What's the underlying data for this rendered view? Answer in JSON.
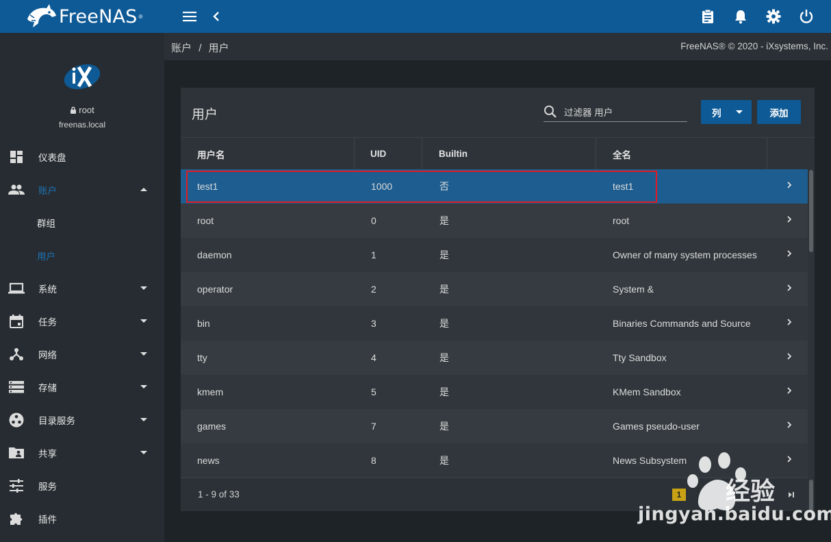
{
  "header": {
    "logo_text": "FreeNAS",
    "logo_mark": "®",
    "icons": [
      "menu-icon",
      "back-icon",
      "clipboard-icon",
      "bell-icon",
      "gear-icon",
      "power-icon"
    ]
  },
  "sidebar": {
    "user": "root",
    "host": "freenas.local",
    "items": [
      {
        "label": "仪表盘",
        "icon": "dashboard-icon"
      },
      {
        "label": "账户",
        "icon": "people-icon",
        "expanded": true
      },
      {
        "label": "群组"
      },
      {
        "label": "用户",
        "active": true
      },
      {
        "label": "系统",
        "icon": "laptop-icon"
      },
      {
        "label": "任务",
        "icon": "calendar-icon"
      },
      {
        "label": "网络",
        "icon": "network-icon"
      },
      {
        "label": "存储",
        "icon": "storage-icon"
      },
      {
        "label": "目录服务",
        "icon": "directory-icon"
      },
      {
        "label": "共享",
        "icon": "folder-share-icon"
      },
      {
        "label": "服务",
        "icon": "sliders-icon"
      },
      {
        "label": "插件",
        "icon": "puzzle-icon"
      }
    ]
  },
  "breadcrumb": {
    "parent": "账户",
    "sep": "/",
    "current": "用户"
  },
  "copyright": "FreeNAS® © 2020 - iXsystems, Inc.",
  "card": {
    "title": "用户",
    "search_placeholder": "过滤器 用户",
    "columns_button": "列",
    "add_button": "添加"
  },
  "table": {
    "headers": [
      "用户名",
      "UID",
      "Builtin",
      "全名"
    ],
    "rows": [
      {
        "username": "test1",
        "uid": "1000",
        "builtin": "否",
        "fullname": "test1"
      },
      {
        "username": "root",
        "uid": "0",
        "builtin": "是",
        "fullname": "root"
      },
      {
        "username": "daemon",
        "uid": "1",
        "builtin": "是",
        "fullname": "Owner of many system processes"
      },
      {
        "username": "operator",
        "uid": "2",
        "builtin": "是",
        "fullname": "System &"
      },
      {
        "username": "bin",
        "uid": "3",
        "builtin": "是",
        "fullname": "Binaries Commands and Source"
      },
      {
        "username": "tty",
        "uid": "4",
        "builtin": "是",
        "fullname": "Tty Sandbox"
      },
      {
        "username": "kmem",
        "uid": "5",
        "builtin": "是",
        "fullname": "KMem Sandbox"
      },
      {
        "username": "games",
        "uid": "7",
        "builtin": "是",
        "fullname": "Games pseudo-user"
      },
      {
        "username": "news",
        "uid": "8",
        "builtin": "是",
        "fullname": "News Subsystem"
      }
    ],
    "pager": "1 - 9 of 33",
    "current_page": "1"
  },
  "watermark": {
    "text": "经验",
    "url": "jingyan.baidu.com"
  },
  "colors": {
    "topbar": "#0e5a96",
    "sidebar": "#262c31",
    "accent": "#1f74b5",
    "highlight": "#e31b23"
  }
}
